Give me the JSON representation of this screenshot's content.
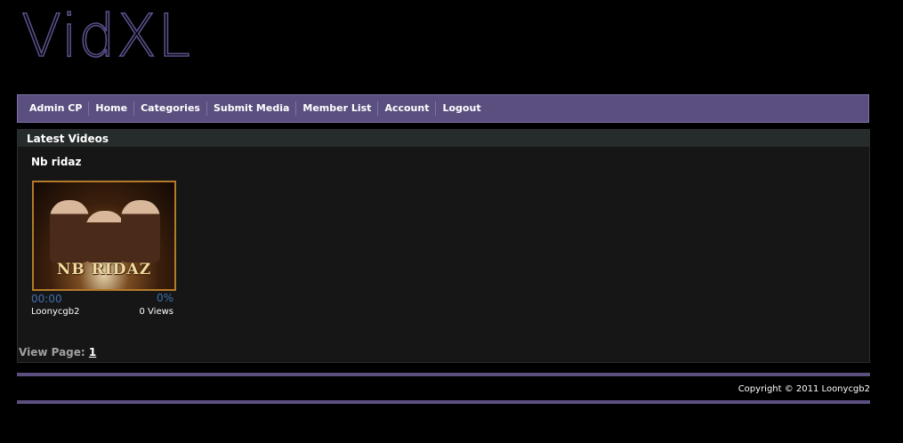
{
  "site": {
    "logo": "VidXL"
  },
  "nav": {
    "items": [
      {
        "label": "Admin CP"
      },
      {
        "label": "Home"
      },
      {
        "label": "Categories"
      },
      {
        "label": "Submit Media"
      },
      {
        "label": "Member List"
      },
      {
        "label": "Account"
      },
      {
        "label": "Logout"
      }
    ]
  },
  "latest": {
    "header": "Latest Videos",
    "video": {
      "title": "Nb ridaz",
      "thumbnail_text": "NB RIDAZ",
      "duration": "00:00",
      "rating": "0%",
      "uploader": "Loonycgb2",
      "views": "0 Views"
    }
  },
  "pager": {
    "label": "View Page:",
    "page": "1"
  },
  "footer": {
    "copyright": "Copyright © 2011 Loonycgb2"
  },
  "colors": {
    "nav_bg": "#5b4f7f",
    "link_blue": "#3f6fb0",
    "content_bg": "#161616"
  }
}
